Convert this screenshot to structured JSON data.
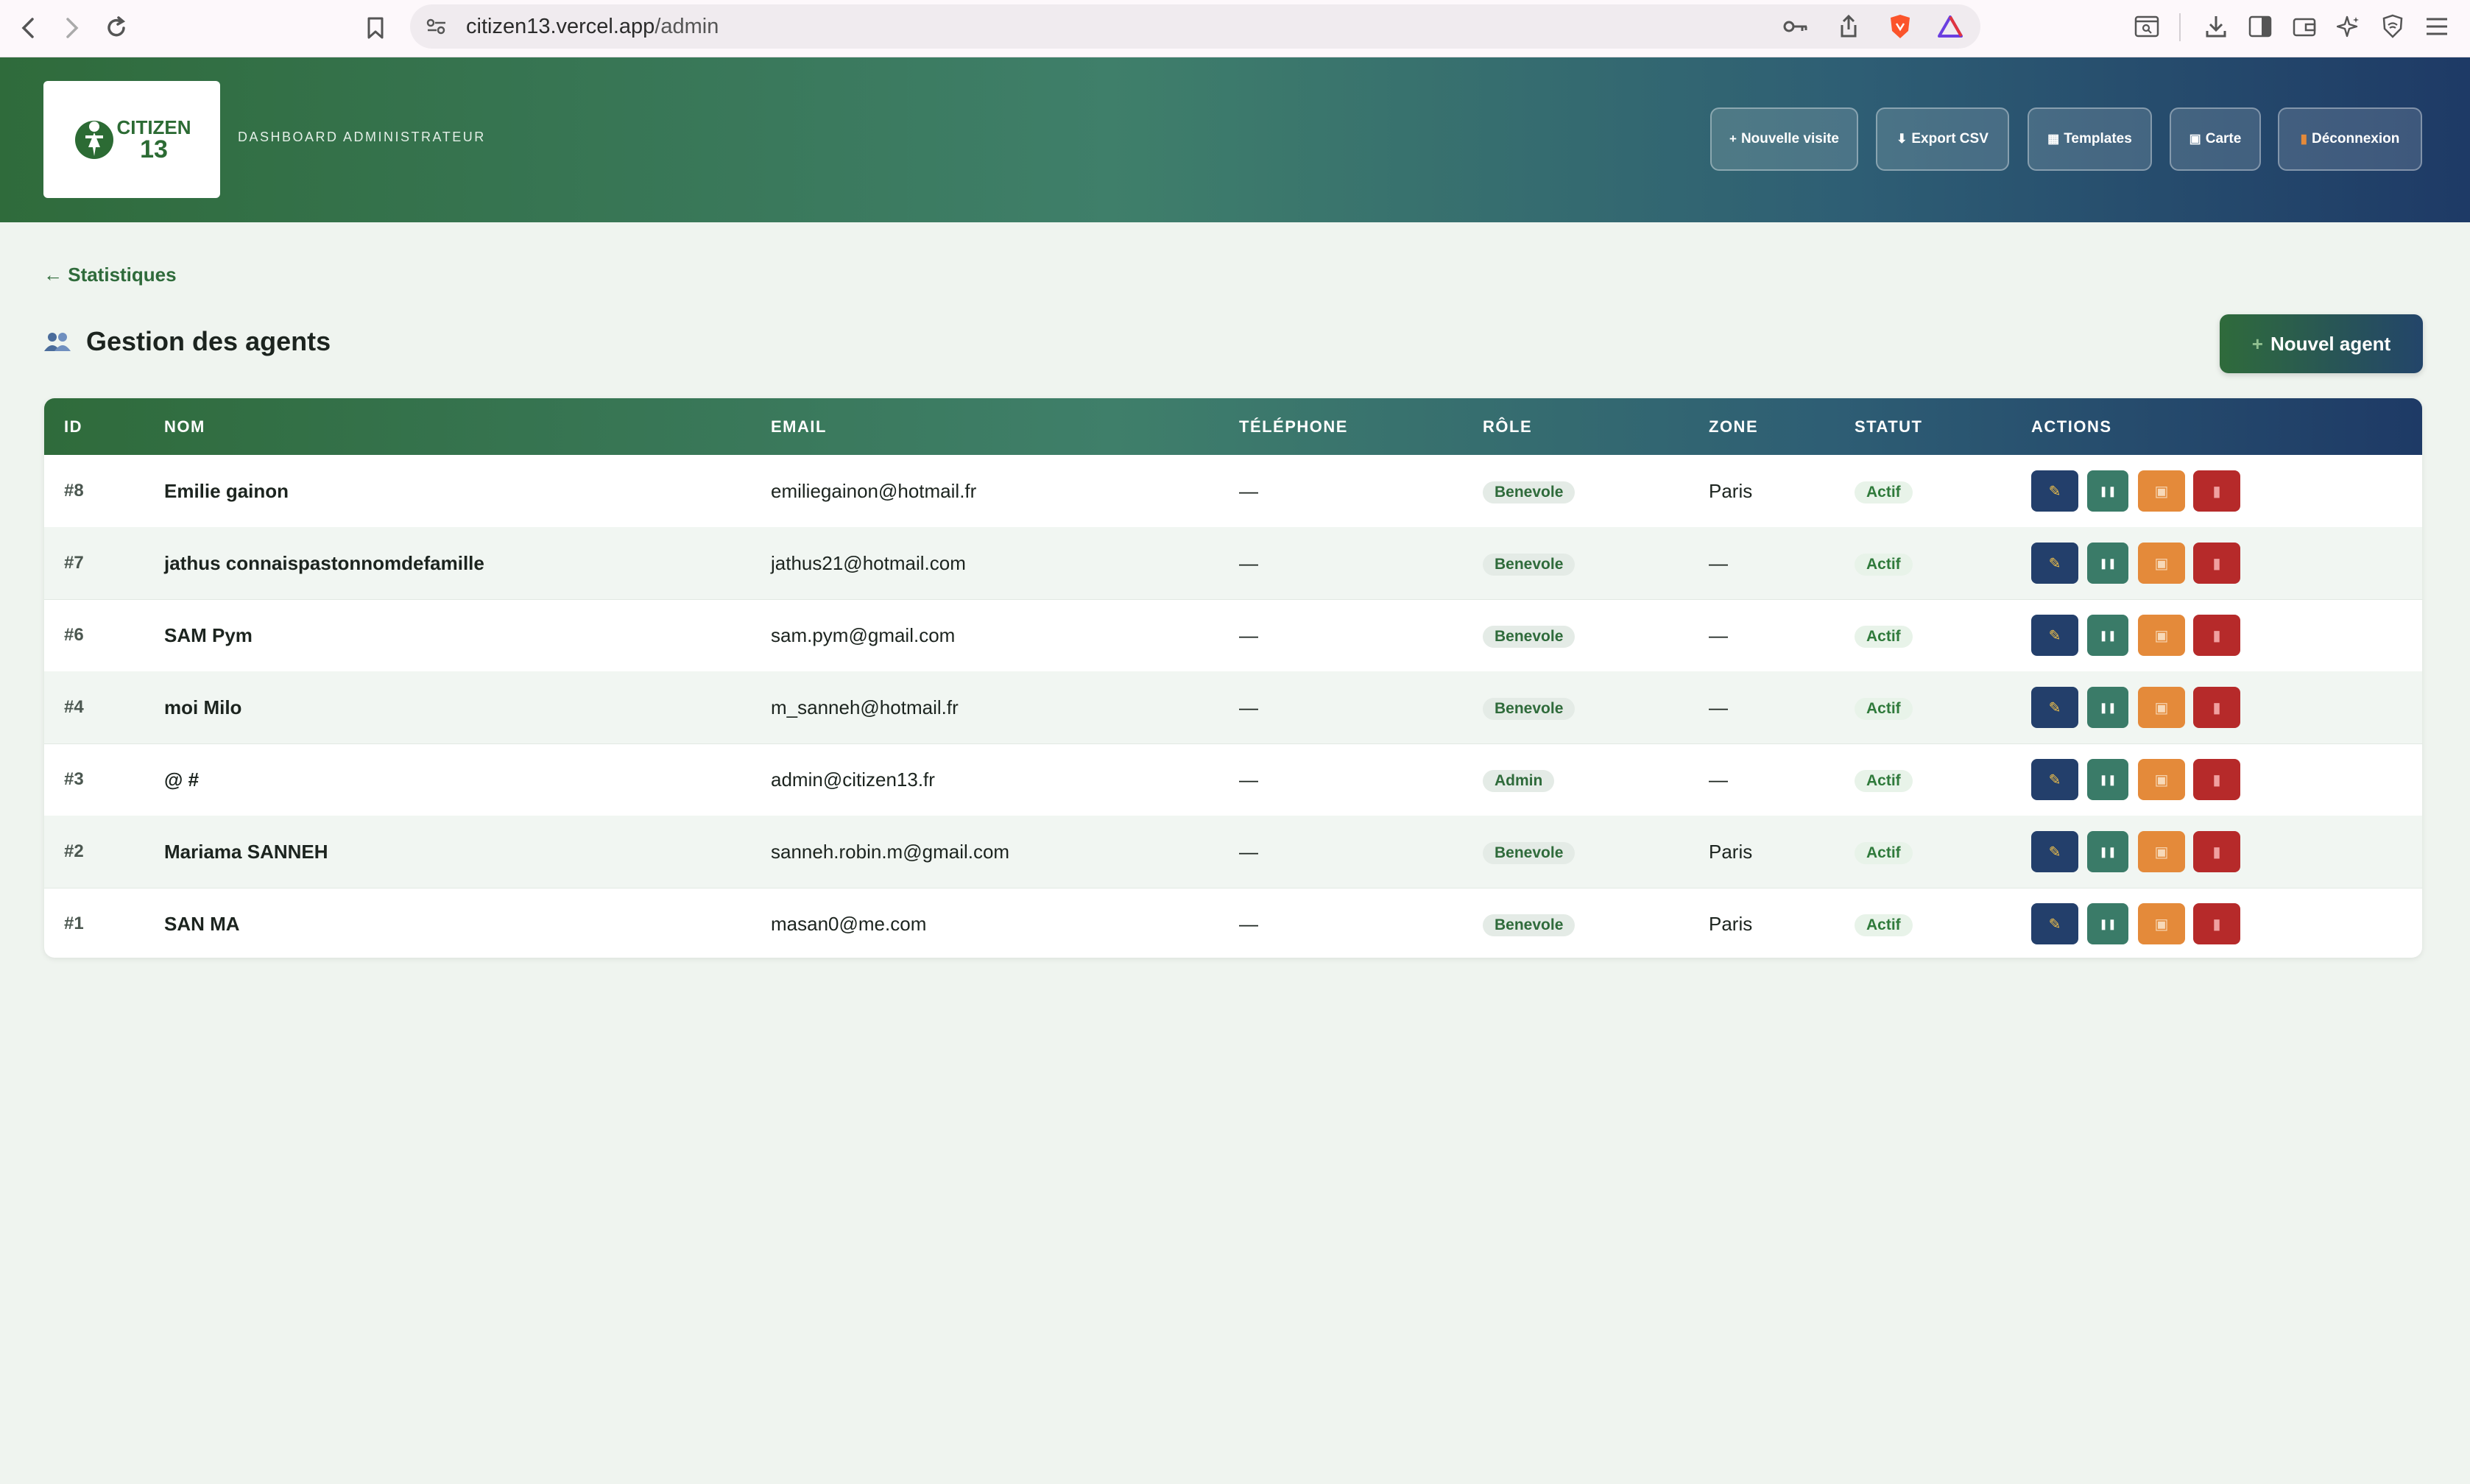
{
  "browser": {
    "url_host": "citizen13.vercel.app",
    "url_path": "/admin"
  },
  "header": {
    "logo_line1": "CITIZEN",
    "logo_line2": "13",
    "subtitle": "DASHBOARD ADMINISTRATEUR",
    "buttons": [
      {
        "icon": "+",
        "label": "Nouvelle visite"
      },
      {
        "icon": "⬇",
        "label": "Export CSV"
      },
      {
        "icon": "▦",
        "label": "Templates"
      },
      {
        "icon": "▣",
        "label": "Carte"
      },
      {
        "icon": "▮",
        "label": "Déconnexion"
      }
    ]
  },
  "main": {
    "back_link": "← Statistiques",
    "title": "Gestion des agents",
    "new_agent_label": "Nouvel agent",
    "new_agent_icon": "+"
  },
  "table": {
    "columns": [
      "ID",
      "NOM",
      "EMAIL",
      "TÉLÉPHONE",
      "RÔLE",
      "ZONE",
      "STATUT",
      "ACTIONS"
    ],
    "rows": [
      {
        "id": "#8",
        "name": "Emilie gainon",
        "email": "emiliegainon@hotmail.fr",
        "phone": "—",
        "role": "Benevole",
        "zone": "Paris",
        "status": "Actif"
      },
      {
        "id": "#7",
        "name": "jathus connaispastonnomdefamille",
        "email": "jathus21@hotmail.com",
        "phone": "—",
        "role": "Benevole",
        "zone": "—",
        "status": "Actif"
      },
      {
        "id": "#6",
        "name": "SAM Pym",
        "email": "sam.pym@gmail.com",
        "phone": "—",
        "role": "Benevole",
        "zone": "—",
        "status": "Actif"
      },
      {
        "id": "#4",
        "name": "moi Milo",
        "email": "m_sanneh@hotmail.fr",
        "phone": "—",
        "role": "Benevole",
        "zone": "—",
        "status": "Actif"
      },
      {
        "id": "#3",
        "name": "@ #",
        "email": "admin@citizen13.fr",
        "phone": "—",
        "role": "Admin",
        "zone": "—",
        "status": "Actif"
      },
      {
        "id": "#2",
        "name": "Mariama SANNEH",
        "email": "sanneh.robin.m@gmail.com",
        "phone": "—",
        "role": "Benevole",
        "zone": "Paris",
        "status": "Actif"
      },
      {
        "id": "#1",
        "name": "SAN MA",
        "email": "masan0@me.com",
        "phone": "—",
        "role": "Benevole",
        "zone": "Paris",
        "status": "Actif"
      }
    ],
    "action_icons": {
      "edit": "✎",
      "pause": "❚❚",
      "card": "▣",
      "delete": "▮"
    }
  },
  "colors": {
    "brand_green": "#2f6b3b",
    "brand_navy": "#1e3a66",
    "edit_blue": "#233f6b",
    "pause_teal": "#3a7b68",
    "card_orange": "#e48a3a",
    "delete_red": "#b62a2a"
  }
}
